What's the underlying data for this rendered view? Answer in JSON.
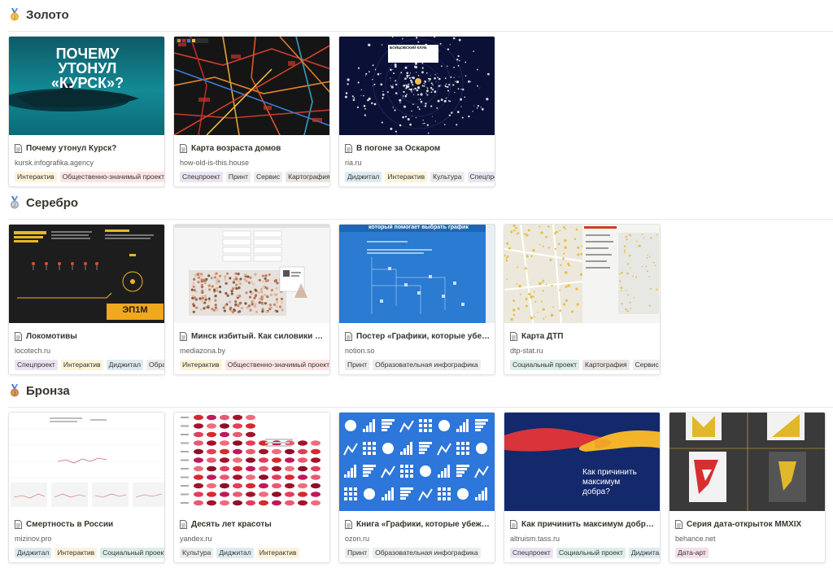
{
  "sections": [
    {
      "title": "Золото",
      "cards": [
        {
          "title": "Почему утонул Курск?",
          "domain": "kursk.infografika.agency",
          "thumb_text": [
            "ПОЧЕМУ",
            "УТОНУЛ",
            "«КУРСК»?"
          ],
          "tags": [
            {
              "label": "Интерактив",
              "color": "yellow"
            },
            {
              "label": "Общественно-значимый проект",
              "color": "red"
            }
          ]
        },
        {
          "title": "Карта возраста домов",
          "domain": "how-old-is-this.house",
          "tags": [
            {
              "label": "Спецпроект",
              "color": "purple"
            },
            {
              "label": "Принт",
              "color": "gray"
            },
            {
              "label": "Сервис",
              "color": "gray"
            },
            {
              "label": "Картография",
              "color": "brown"
            }
          ]
        },
        {
          "title": "В погоне за Оскаром",
          "domain": "ria.ru",
          "thumb_text": [
            "БОЙЦОВСКИЙ КЛУБ"
          ],
          "tags": [
            {
              "label": "Диджитал",
              "color": "blue"
            },
            {
              "label": "Интерактив",
              "color": "yellow"
            },
            {
              "label": "Культура",
              "color": "gray"
            },
            {
              "label": "Спецпроект",
              "color": "purple"
            }
          ]
        }
      ]
    },
    {
      "title": "Серебро",
      "cards": [
        {
          "title": "Локомотивы",
          "domain": "locotech.ru",
          "thumb_text": [
            "ЭП1М"
          ],
          "tags": [
            {
              "label": "Спецпроект",
              "color": "purple"
            },
            {
              "label": "Интерактив",
              "color": "yellow"
            },
            {
              "label": "Диджитал",
              "color": "blue"
            },
            {
              "label": "Образовательная инфографика",
              "color": "gray"
            }
          ]
        },
        {
          "title": "Минск избитый. Как силовики ка...",
          "domain": "mediazona.by",
          "tags": [
            {
              "label": "Интерактив",
              "color": "yellow"
            },
            {
              "label": "Общественно-значимый проект",
              "color": "red"
            }
          ]
        },
        {
          "title": "Постер «Графики, которые убежд...",
          "domain": "notion.so",
          "thumb_text": [
            "который помогает выбрать график"
          ],
          "tags": [
            {
              "label": "Принт",
              "color": "gray"
            },
            {
              "label": "Образовательная инфографика",
              "color": "gray"
            }
          ]
        },
        {
          "title": "Карта ДТП",
          "domain": "dtp-stat.ru",
          "tags": [
            {
              "label": "Социальный проект",
              "color": "green"
            },
            {
              "label": "Картография",
              "color": "brown"
            },
            {
              "label": "Сервис",
              "color": "gray"
            }
          ]
        }
      ]
    },
    {
      "title": "Бронза",
      "cards": [
        {
          "title": "Смертность в России",
          "domain": "mizinov.pro",
          "tags": [
            {
              "label": "Диджитал",
              "color": "blue"
            },
            {
              "label": "Интерактив",
              "color": "yellow"
            },
            {
              "label": "Социальный проект",
              "color": "green"
            }
          ]
        },
        {
          "title": "Десять лет красоты",
          "domain": "yandex.ru",
          "tags": [
            {
              "label": "Культура",
              "color": "gray"
            },
            {
              "label": "Диджитал",
              "color": "blue"
            },
            {
              "label": "Интерактив",
              "color": "yellow"
            }
          ]
        },
        {
          "title": "Книга «Графики, которые убежда...",
          "domain": "ozon.ru",
          "tags": [
            {
              "label": "Принт",
              "color": "gray"
            },
            {
              "label": "Образовательная инфографика",
              "color": "gray"
            }
          ]
        },
        {
          "title": "Как причинить максимум добра?",
          "domain": "altruism.tass.ru",
          "thumb_text": [
            "Как причинить",
            "максимум",
            "добра?"
          ],
          "tags": [
            {
              "label": "Спецпроект",
              "color": "purple"
            },
            {
              "label": "Социальный проект",
              "color": "green"
            },
            {
              "label": "Диджитал",
              "color": "blue"
            }
          ]
        },
        {
          "title": "Серия дата-открыток MMXIX",
          "domain": "behance.net",
          "tags": [
            {
              "label": "Дата-арт",
              "color": "pink"
            }
          ]
        }
      ]
    }
  ]
}
